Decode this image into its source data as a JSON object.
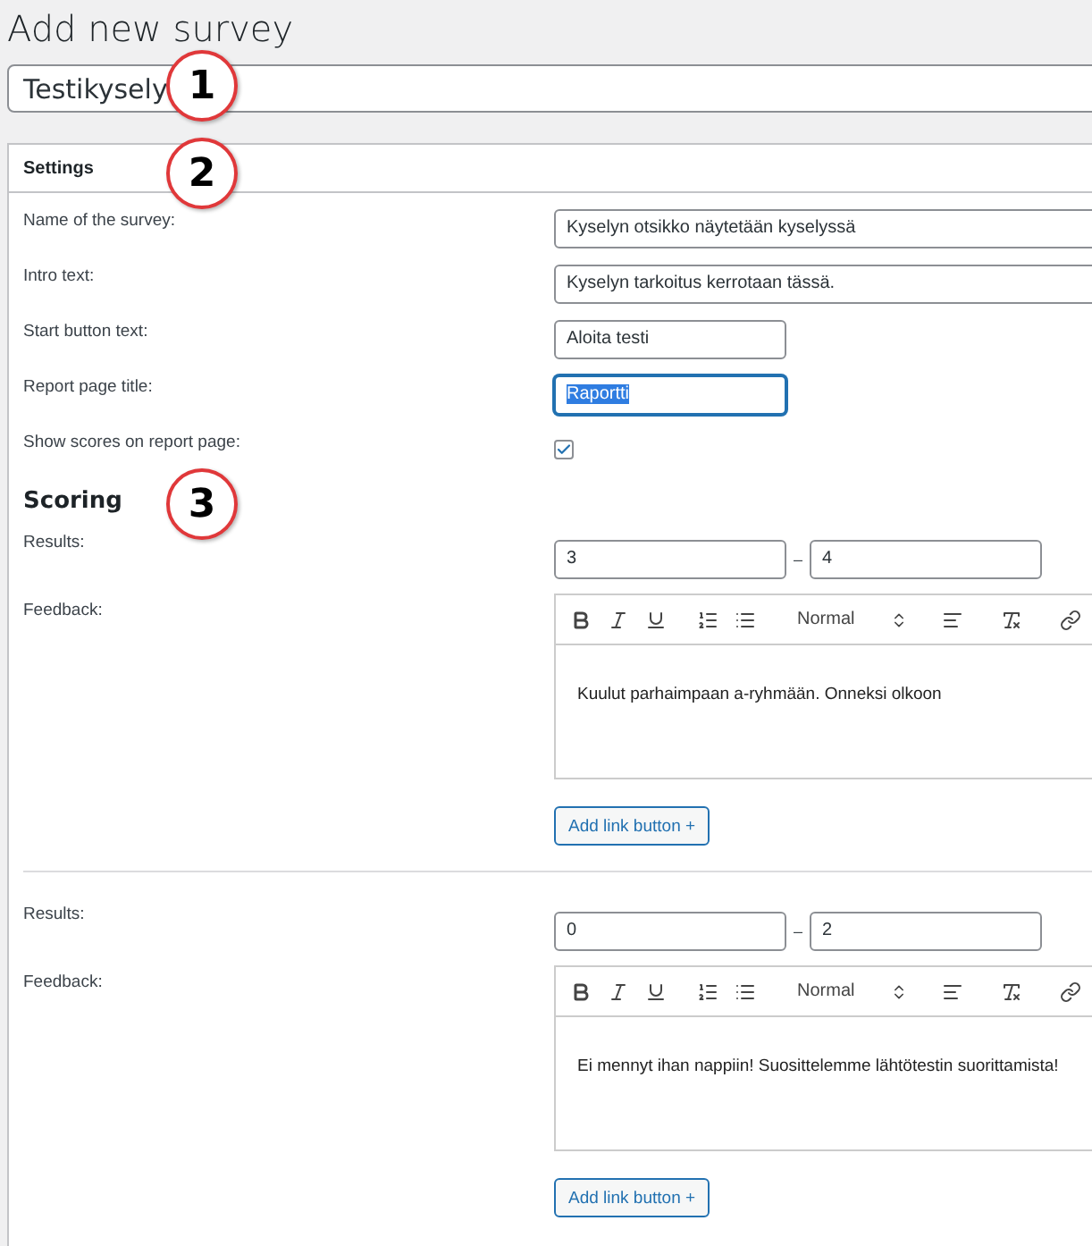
{
  "page_title": "Add new survey",
  "survey_title": "Testikysely",
  "settings": {
    "title": "Settings",
    "fields": [
      {
        "kind": "wide",
        "label": "Name of the survey:",
        "value": "Kyselyn otsikko näytetään kyselyssä"
      },
      {
        "kind": "wide",
        "label": "Intro text:",
        "value": "Kyselyn tarkoitus kerrotaan tässä."
      },
      {
        "kind": "short",
        "label": "Start button text:",
        "value": "Aloita testi"
      },
      {
        "kind": "short",
        "label": "Report page title:",
        "value": "Raportti",
        "focused": true
      },
      {
        "kind": "checkbox",
        "label": "Show scores on report page:",
        "checked": true
      }
    ]
  },
  "scoring": {
    "title": "Scoring",
    "blocks": [
      {
        "results_label": "Results:",
        "from": "3",
        "separator": "–",
        "to": "4",
        "feedback_label": "Feedback:",
        "format": "Normal",
        "feedback": "Kuulut parhaimpaan a-ryhmään. Onneksi olkoon",
        "button": "Add link button +"
      },
      {
        "results_label": "Results:",
        "from": "0",
        "separator": "–",
        "to": "2",
        "feedback_label": "Feedback:",
        "format": "Normal",
        "feedback": "Ei mennyt ihan nappiin! Suosittelemme lähtötestin suorittamista!",
        "button": "Add link button +"
      }
    ]
  },
  "annotations": [
    "1",
    "2",
    "3"
  ]
}
